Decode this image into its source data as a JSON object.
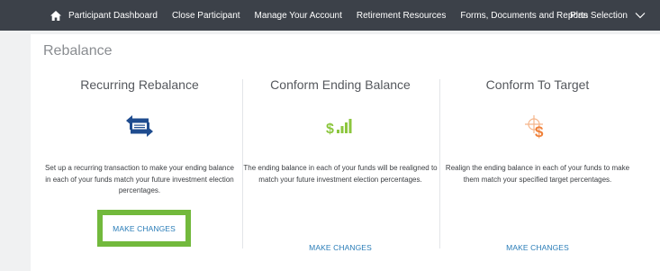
{
  "nav": {
    "home_label": "Participant Dashboard",
    "items": [
      {
        "label": "Close Participant"
      },
      {
        "label": "Manage Your Account"
      },
      {
        "label": "Retirement Resources"
      },
      {
        "label": "Forms, Documents and Reports"
      }
    ],
    "plan_selection": "Plan Selection"
  },
  "page": {
    "title": "Rebalance"
  },
  "cards": [
    {
      "title": "Recurring Rebalance",
      "icon": "recurring-rebalance-icon",
      "description": "Set up a recurring transaction to make your ending balance in each of your funds match your future investment election percentages.",
      "link": "MAKE CHANGES"
    },
    {
      "title": "Conform Ending Balance",
      "icon": "dollar-bars-icon",
      "description": "The ending balance in each of your funds will be realigned to match your future investment election percentages.",
      "link": "MAKE CHANGES"
    },
    {
      "title": "Conform To Target",
      "icon": "dollar-target-icon",
      "description": "Realign the ending balance in each of your funds to make them match your specified target percentages.",
      "link": "MAKE CHANGES"
    }
  ],
  "colors": {
    "nav_bg": "#3c4149",
    "icon_blue": "#1f4c8f",
    "icon_green": "#8cc63e",
    "icon_orange": "#f0813a",
    "link_blue": "#2a7db8",
    "highlight_green": "#72b93c"
  }
}
